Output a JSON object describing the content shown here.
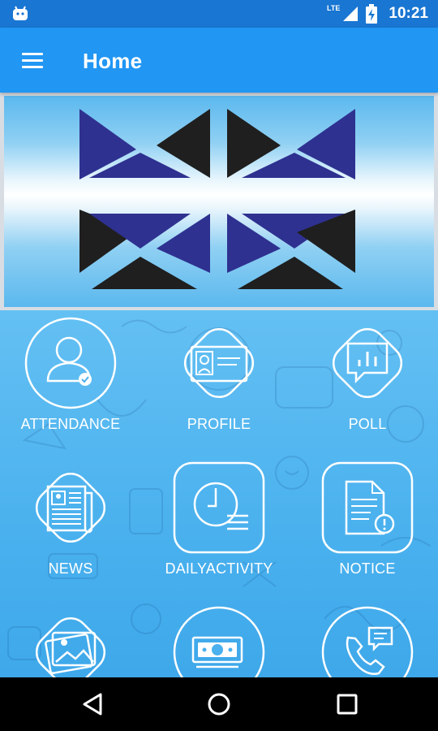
{
  "status_bar": {
    "network": "LTE",
    "time": "10:21"
  },
  "app_bar": {
    "title": "Home",
    "menu_icon": "hamburger-menu-icon"
  },
  "banner": {
    "logo": "school-logo",
    "colors": {
      "blue": "#2E3190",
      "black": "#1f1f1f"
    }
  },
  "menu_tiles": [
    {
      "label": "ATTENDANCE",
      "icon": "attendance-icon"
    },
    {
      "label": "PROFILE",
      "icon": "profile-card-icon"
    },
    {
      "label": "POLL",
      "icon": "poll-chart-icon"
    },
    {
      "label": "NEWS",
      "icon": "newspaper-icon"
    },
    {
      "label": "DAILYACTIVITY",
      "icon": "clock-activity-icon"
    },
    {
      "label": "NOTICE",
      "icon": "notice-document-icon"
    },
    {
      "label": "",
      "icon": "gallery-icon"
    },
    {
      "label": "",
      "icon": "fees-money-icon"
    },
    {
      "label": "",
      "icon": "contact-phone-icon"
    }
  ],
  "nav_bar": {
    "back": "back-triangle-icon",
    "home": "home-circle-icon",
    "recents": "recents-square-icon"
  },
  "colors": {
    "status_bar": "#1976D2",
    "app_bar": "#2196F3",
    "grid_background": "#4ab1ee"
  }
}
